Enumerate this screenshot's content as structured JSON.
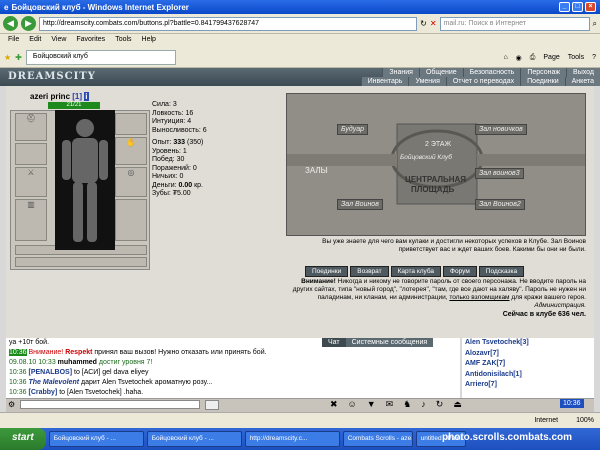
{
  "window": {
    "title": "Бойцовский клуб - Windows Internet Explorer"
  },
  "address": {
    "url": "http://dreamscity.combats.com/buttons.pl?battle=0.841799437628747",
    "search_placeholder": "mail.ru: Поиск в Интернет"
  },
  "menu": [
    "File",
    "Edit",
    "View",
    "Favorites",
    "Tools",
    "Help"
  ],
  "tab": {
    "label": "Бойцовский клуб"
  },
  "toolbar": {
    "page_label": "Page",
    "tools_label": "Tools"
  },
  "game": {
    "logo": "DREAMSCITY",
    "nav_top": [
      "Знания",
      "Общение",
      "Безопасность",
      "Персонаж",
      "Выход"
    ],
    "nav_bottom": [
      "Инвентарь",
      "Умения",
      "Отчет о переводах",
      "Поединки",
      "Анкета"
    ]
  },
  "character": {
    "name": "azeri princ",
    "level": "[1]",
    "hp": "21/21",
    "stats": [
      "Сила: 3",
      "Ловкость: 16",
      "Интуиция: 4",
      "Выносливость: 6"
    ],
    "exp_label": "Опыт:",
    "exp_value": "333",
    "exp_next": "(350)",
    "level_line": "Уровень: 1",
    "wins": "Побед: 30",
    "losses": "Поражений: 0",
    "draws": "Ничьих: 0",
    "money_label": "Деньги:",
    "money_value": "0.00",
    "money_unit": "кр.",
    "teeth": "Зубы: ₮5.00"
  },
  "map": {
    "doors": [
      "Будуар",
      "Зал новичков",
      "Зал Воинов",
      "Зал Воинов2",
      "Зал воинов3"
    ],
    "floor": "2 ЭТАЖ",
    "zone": "ЗАЛЫ",
    "club": "Бойцовский Клуб",
    "square1": "ЦЕНТРАЛЬНАЯ",
    "square2": "ПЛОЩАДЬ"
  },
  "welcome": "Вы уже знаете для чего вам кулаки и достигли некоторых успехов в Клубе. Зал Воинов приветствует вас и ждет ваших боев. Какими бы они ни были.",
  "buttons": [
    "Поединки",
    "Возврат",
    "Карта клуба",
    "Форум",
    "Подсказка"
  ],
  "warning": {
    "bold": "Внимание!",
    "text": "Никогда и никому не говорите пароль от своего персонажа. Не вводите пароль на других сайтах, типа \"новый город\", \"лотерея\", \"там, где все дают на халяву\". Пароль не нужен ни паладинам, ни кланам, ни администрации,",
    "link": "только взломщикам",
    "tail": "для кражи вашего героя.",
    "sign": "Администрация."
  },
  "online": "Сейчас в клубе 636 чел.",
  "chat": {
    "tabs": [
      "Чат",
      "Системные сообщения"
    ],
    "lines": [
      {
        "time": "",
        "text": "уа +10т бой."
      },
      {
        "time": "10:36",
        "prefix": "Внимание!",
        "name": "Respekt",
        "text": "принял ваш вызов! Нужно отказать или принять бой."
      },
      {
        "time": "09.08.10 10:33",
        "name": "muhammed",
        "text": "достиг уровня 7!"
      },
      {
        "time": "10:36",
        "name": "[PENALBOS]",
        "text": "to [АСИ] gel dava eliyey"
      },
      {
        "time": "10:36",
        "name": "The Malevolent",
        "text": "дарит Alen Tsvetochek ароматную розу..."
      },
      {
        "time": "10:36",
        "name": "[Crabby]",
        "text": "to [Alen Tsvetochek] .haha."
      }
    ]
  },
  "users": [
    "Alen Tsvetochek[3]",
    "Alozavr[7]",
    "AMF ZAK[7]",
    "Antidonisilach[1]",
    "Arriero[7]"
  ],
  "status": {
    "zone": "Internet",
    "zoom": "100%"
  },
  "taskbar": {
    "start": "start",
    "tasks": [
      "Бойцовский клуб - ...",
      "Бойцовский клуб - ...",
      "http://dreamscity.c...",
      "Combats Scrolls - aze...",
      "untitled - Paint"
    ],
    "clock": "10:36"
  },
  "watermark": "photo.scrolls.combats.com"
}
